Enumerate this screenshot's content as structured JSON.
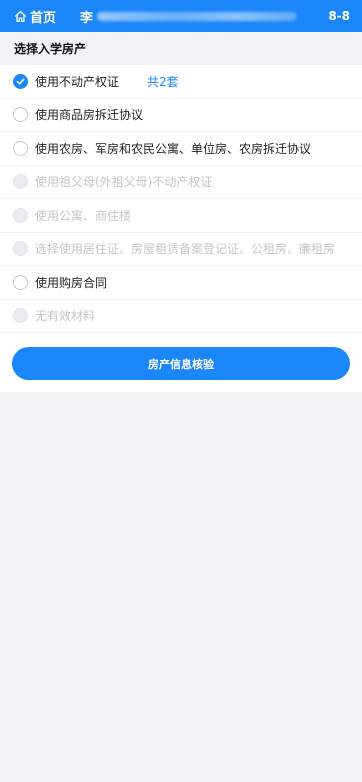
{
  "header": {
    "home_label": "首页",
    "user_name": "李",
    "grade": "8-8",
    "colors": {
      "bar": "#1a86f7"
    }
  },
  "section": {
    "title": "选择入学房产"
  },
  "options": [
    {
      "label": "使用不动产权证",
      "checked": true,
      "disabled": false,
      "count": "共2套"
    },
    {
      "label": "使用商品房拆迁协议",
      "checked": false,
      "disabled": false
    },
    {
      "label": "使用农房、军房和农民公寓、单位房、农房拆迁协议",
      "checked": false,
      "disabled": false
    },
    {
      "label": "使用祖父母(外祖父母)不动产权证",
      "checked": false,
      "disabled": true
    },
    {
      "label": "使用公寓、商住楼",
      "checked": false,
      "disabled": true
    },
    {
      "label": "选择使用居住证、房屋租赁备案登记证、公租房、廉租房",
      "checked": false,
      "disabled": true
    },
    {
      "label": "使用购房合同",
      "checked": false,
      "disabled": false
    },
    {
      "label": "无有效材料",
      "checked": false,
      "disabled": true
    }
  ],
  "actions": {
    "verify_label": "房产信息核验"
  }
}
